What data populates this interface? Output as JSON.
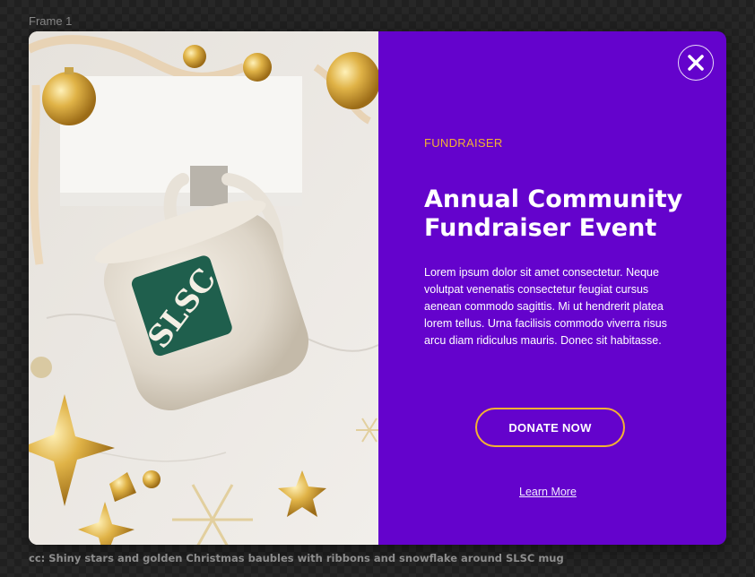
{
  "frame": {
    "label": "Frame 1"
  },
  "modal": {
    "image": {
      "mug_logo_text": "SLSC"
    },
    "eyebrow": "FUNDRAISER",
    "title": "Annual Community Fundraiser Event",
    "body": "Lorem ipsum dolor sit amet consectetur. Neque volutpat venenatis consectetur feugiat cursus aenean commodo sagittis. Mi ut hendrerit platea lorem tellus. Urna facilisis commodo viverra risus arcu diam ridiculus mauris. Donec sit habitasse.",
    "donate_label": "DONATE NOW",
    "learn_more_label": "Learn More",
    "close_icon": "close-icon"
  },
  "caption": "cc: Shiny stars and golden Christmas baubles with ribbons and snowflake around SLSC mug",
  "colors": {
    "panel": "#6403cc",
    "accent": "#f2b233",
    "text": "#ffffff"
  }
}
